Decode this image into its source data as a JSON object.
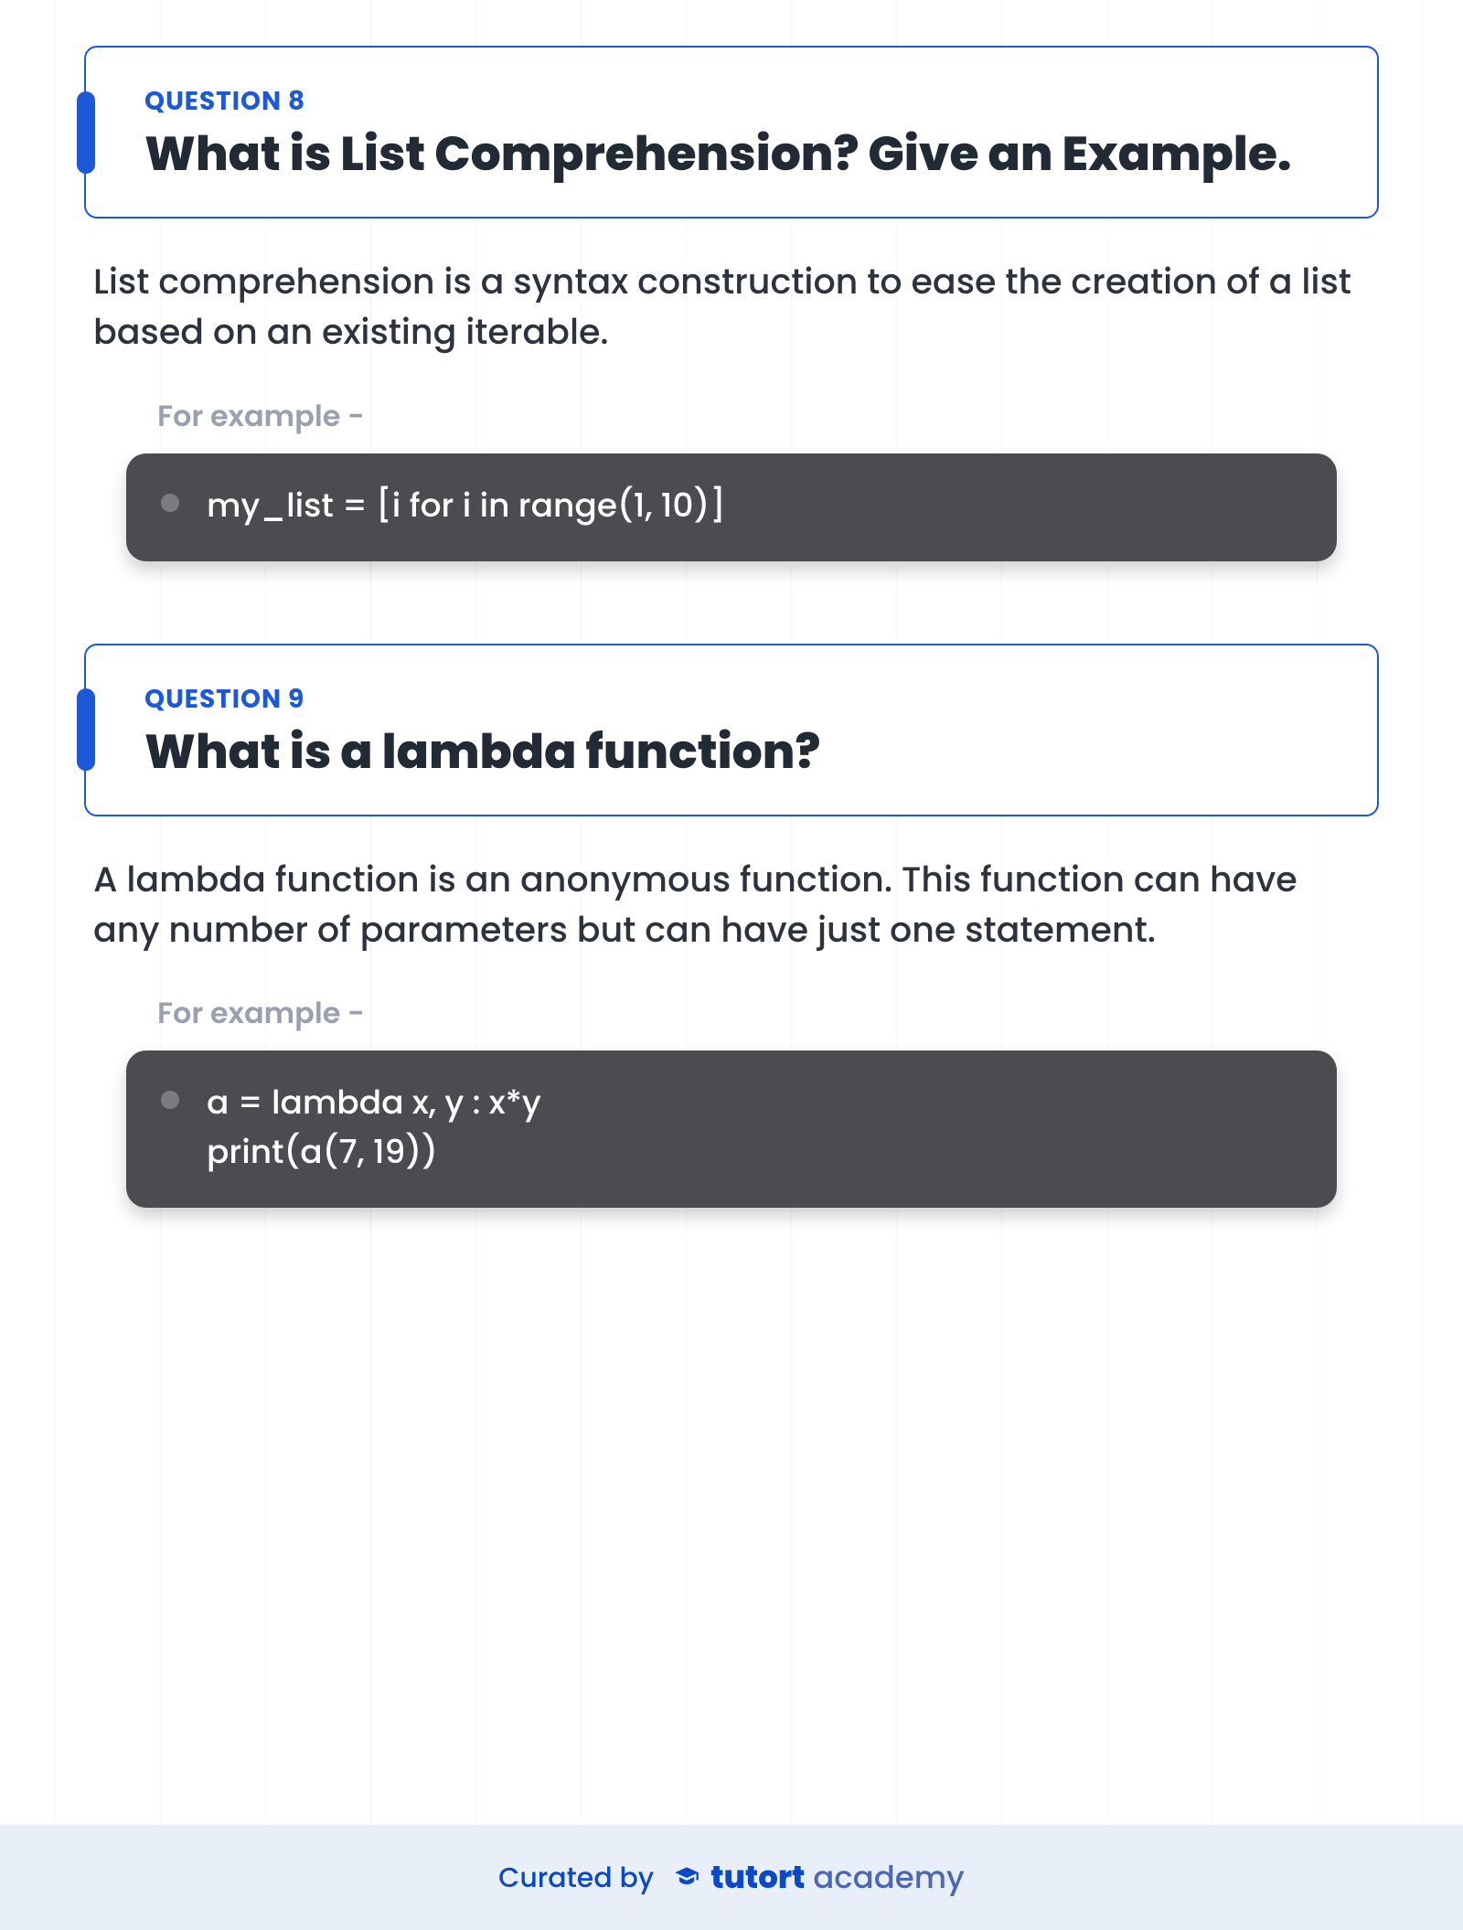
{
  "questions": [
    {
      "label": "QUESTION 8",
      "title": "What is List Comprehension? Give an Example.",
      "answer": "List comprehension is a syntax construction to ease the creation of a list based on an existing iterable.",
      "example_label": "For example -",
      "code": "my_list = [i for i in range(1, 10)]"
    },
    {
      "label": "QUESTION 9",
      "title": "What is a lambda function?",
      "answer": "A lambda function is an anonymous function. This function can have any number of parameters but can have just one statement.",
      "example_label": "For example -",
      "code": "a = lambda x, y : x*y\nprint(a(7, 19))"
    }
  ],
  "footer": {
    "curated": "Curated by",
    "brand_strong": "tutort",
    "brand_light": " academy"
  }
}
